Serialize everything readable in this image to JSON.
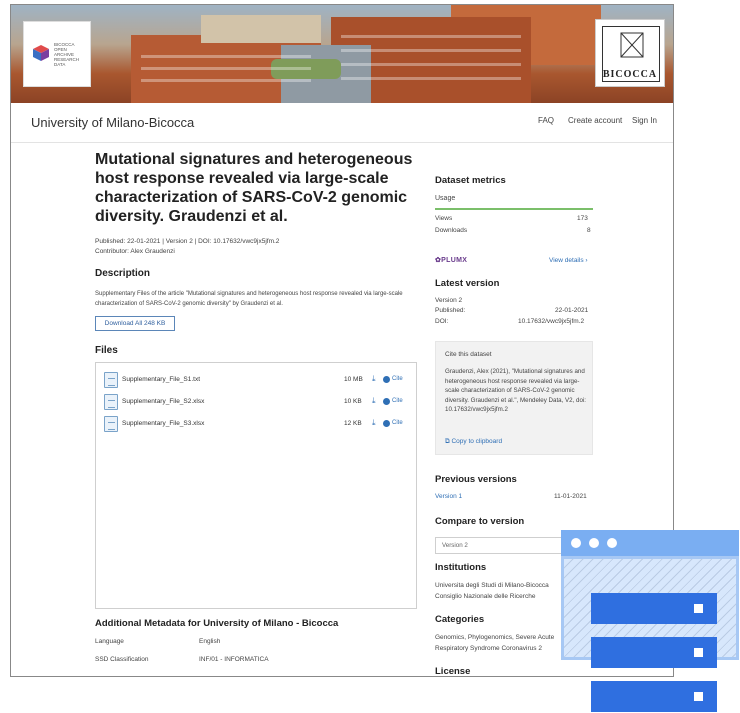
{
  "banner": {
    "left_logo_lines": "BICOCCA\nOPEN\nARCHIVE\nRESEARCH\nDATA",
    "right_logo_vertical": "UNIVERSITÀ DEGLI STUDI DI MILANO",
    "right_logo_name": "BICOCCA"
  },
  "header": {
    "site_name": "University of Milano-Bicocca",
    "nav": {
      "faq": "FAQ",
      "create_account": "Create account",
      "sign_in": "Sign In"
    }
  },
  "dataset": {
    "title": "Mutational signatures and heterogeneous host response revealed via large-scale characterization of SARS-CoV-2 genomic diversity. Graudenzi et al.",
    "published_line": "Published: 22-01-2021 | Version 2 | DOI: 10.17632/vwc9jx5jfm.2",
    "contributor_line": "Contributor:  Alex Graudenzi",
    "description_heading": "Description",
    "description": "Supplementary Files of the article \"Mutational signatures and heterogeneous host response revealed via large-scale characterization of  SARS-CoV-2 genomic diversity\" by Graudenzi et al.",
    "download_all": "Download All 248 KB",
    "files_heading": "Files",
    "files": [
      {
        "name": "Supplementary_File_S1.txt",
        "size": "10 MB",
        "cite": "Cite"
      },
      {
        "name": "Supplementary_File_S2.xlsx",
        "size": "10 KB",
        "cite": "Cite"
      },
      {
        "name": "Supplementary_File_S3.xlsx",
        "size": "12 KB",
        "cite": "Cite"
      }
    ],
    "additional_heading": "Additional Metadata for University of Milano - Bicocca",
    "metadata": [
      {
        "key": "Language",
        "value": "English"
      },
      {
        "key": "SSD Classification",
        "value": "INF/01 - INFORMATICA"
      }
    ]
  },
  "sidebar": {
    "metrics_heading": "Dataset metrics",
    "usage_tab": "Usage",
    "views_label": "Views",
    "views_value": "173",
    "downloads_label": "Downloads",
    "downloads_value": "8",
    "plumx": "PLUMX",
    "view_details": "View details  ›",
    "latest_heading": "Latest version",
    "latest_version": "Version 2",
    "published_label": "Published:",
    "published_value": "22-01-2021",
    "doi_label": "DOI:",
    "doi_value": "10.17632/vwc9jx5jfm.2",
    "cite_heading": "Cite this dataset",
    "cite_text": "Graudenzi, Alex (2021), \"Mutational signatures and heterogeneous host response revealed via large-scale characterization of  SARS-CoV-2 genomic diversity. Graudenzi et al.\", Mendeley Data, V2, doi: 10.17632/vwc9jx5jfm.2",
    "copy_clipboard": "Copy to clipboard",
    "previous_heading": "Previous versions",
    "previous_version": "Version 1",
    "previous_date": "11-01-2021",
    "compare_heading": "Compare to version",
    "compare_value": "Version 2",
    "institutions_heading": "Institutions",
    "institution_1": "Universita degli Studi di Milano-Bicocca",
    "institution_2": "Consiglio Nazionale delle Ricerche",
    "categories_heading": "Categories",
    "categories_text_1": "Genomics, Phylogenomics, Severe Acute",
    "categories_text_2": "Respiratory Syndrome Coronavirus 2",
    "license_heading": "License"
  },
  "colors": {
    "link": "#2f6fb5",
    "accent_green": "#7bbf6a",
    "overlay_blue": "#2f6fe0"
  }
}
